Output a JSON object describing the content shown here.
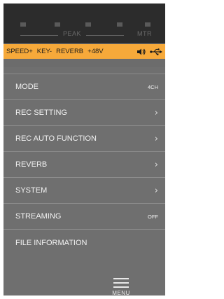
{
  "meter": {
    "peak_label": "PEAK",
    "mtr_label": "MTR"
  },
  "status": {
    "items": [
      "SPEED+",
      "KEY-",
      "REVERB",
      "+48V"
    ],
    "icons": [
      "speaker-icon",
      "usb-icon"
    ]
  },
  "menu": {
    "items": [
      {
        "label": "MODE",
        "value": "4CH"
      },
      {
        "label": "REC SETTING",
        "value": "›"
      },
      {
        "label": "REC AUTO FUNCTION",
        "value": "›"
      },
      {
        "label": "REVERB",
        "value": "›"
      },
      {
        "label": "SYSTEM",
        "value": "›"
      },
      {
        "label": "STREAMING",
        "value": "OFF"
      },
      {
        "label": "FILE INFORMATION",
        "value": ""
      }
    ]
  },
  "bottom": {
    "menu_label": "MENU",
    "menu_icon": "hamburger-icon"
  }
}
